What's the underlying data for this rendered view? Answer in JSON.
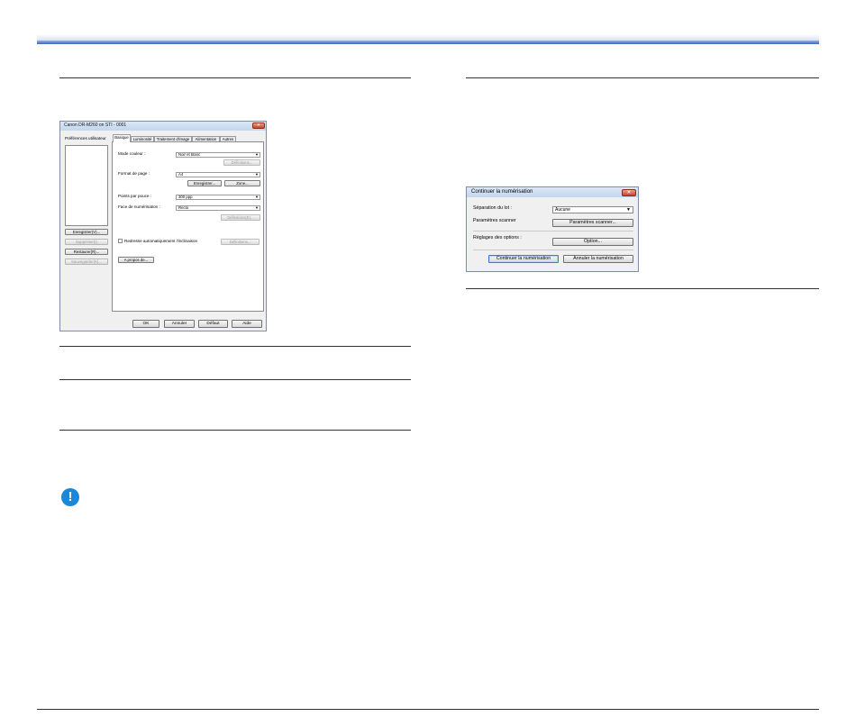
{
  "dialog_scanner": {
    "title": "Canon DR-M260 on STI - 0001",
    "close": "✕",
    "user_prefs_label": "Préférences utilisateur",
    "left_buttons": [
      {
        "label": "Enregistrer(V)...",
        "enabled": true
      },
      {
        "label": "Supprimer(I)",
        "enabled": false
      },
      {
        "label": "Restaurer(R)...",
        "enabled": true
      },
      {
        "label": "Sauvegarder(K)...",
        "enabled": false
      }
    ],
    "tabs": [
      "Basique",
      "Luminosité",
      "Traitement d'image",
      "Alimentation",
      "Autres"
    ],
    "active_tab": "Basique",
    "fields": {
      "mode_label": "Mode couleur :",
      "mode_value": "Noir et blanc",
      "mode_detail": "Définitions...",
      "format_label": "Format de page :",
      "format_value": "A4",
      "save_btn": "Enregistrer...",
      "zone_btn": "Zone...",
      "dpi_label": "Points par pouce :",
      "dpi_value": "300 ppp",
      "face_label": "Face de numérisation :",
      "face_value": "Recto",
      "face_detail": "Définitions(E)...",
      "deskew_label": "Redresse automatiquement l'inclinaison",
      "deskew_detail": "Définitions...",
      "about_btn": "A propos de..."
    },
    "bottom_buttons": [
      "OK",
      "Annuler",
      "Défaut",
      "Aide"
    ]
  },
  "dialog_continue": {
    "title": "Continuer la numérisation",
    "close": "✕",
    "batch_label": "Séparation du lot :",
    "batch_value": "Aucune",
    "scanner_params_label": "Paramètres scanner",
    "scanner_params_btn": "Paramètres scanner...",
    "options_label": "Réglages des options :",
    "options_btn": "Option...",
    "continue_btn": "Continuer la numérisation",
    "cancel_btn": "Annuler la numérisation"
  },
  "important_icon": "!",
  "colors": {
    "header_bar": "#3a63c2",
    "important": "#1a88d8",
    "close_button": "#c4442c"
  }
}
